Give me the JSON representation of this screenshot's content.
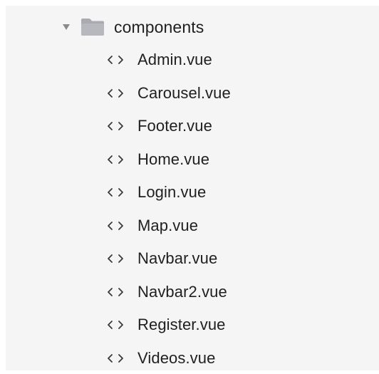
{
  "folder": {
    "name": "components",
    "expanded": true,
    "icon": "folder-icon"
  },
  "files": [
    {
      "name": "Admin.vue",
      "icon": "code-file-icon"
    },
    {
      "name": "Carousel.vue",
      "icon": "code-file-icon"
    },
    {
      "name": "Footer.vue",
      "icon": "code-file-icon"
    },
    {
      "name": "Home.vue",
      "icon": "code-file-icon"
    },
    {
      "name": "Login.vue",
      "icon": "code-file-icon"
    },
    {
      "name": "Map.vue",
      "icon": "code-file-icon"
    },
    {
      "name": "Navbar.vue",
      "icon": "code-file-icon"
    },
    {
      "name": "Navbar2.vue",
      "icon": "code-file-icon"
    },
    {
      "name": "Register.vue",
      "icon": "code-file-icon"
    },
    {
      "name": "Videos.vue",
      "icon": "code-file-icon"
    }
  ],
  "colors": {
    "panel_background": "#f5f5f5",
    "text": "#1f1f1f",
    "icon": "#3a3a3a",
    "folder_fill": "#a9abb0",
    "disclosure": "#8a8a8a"
  }
}
